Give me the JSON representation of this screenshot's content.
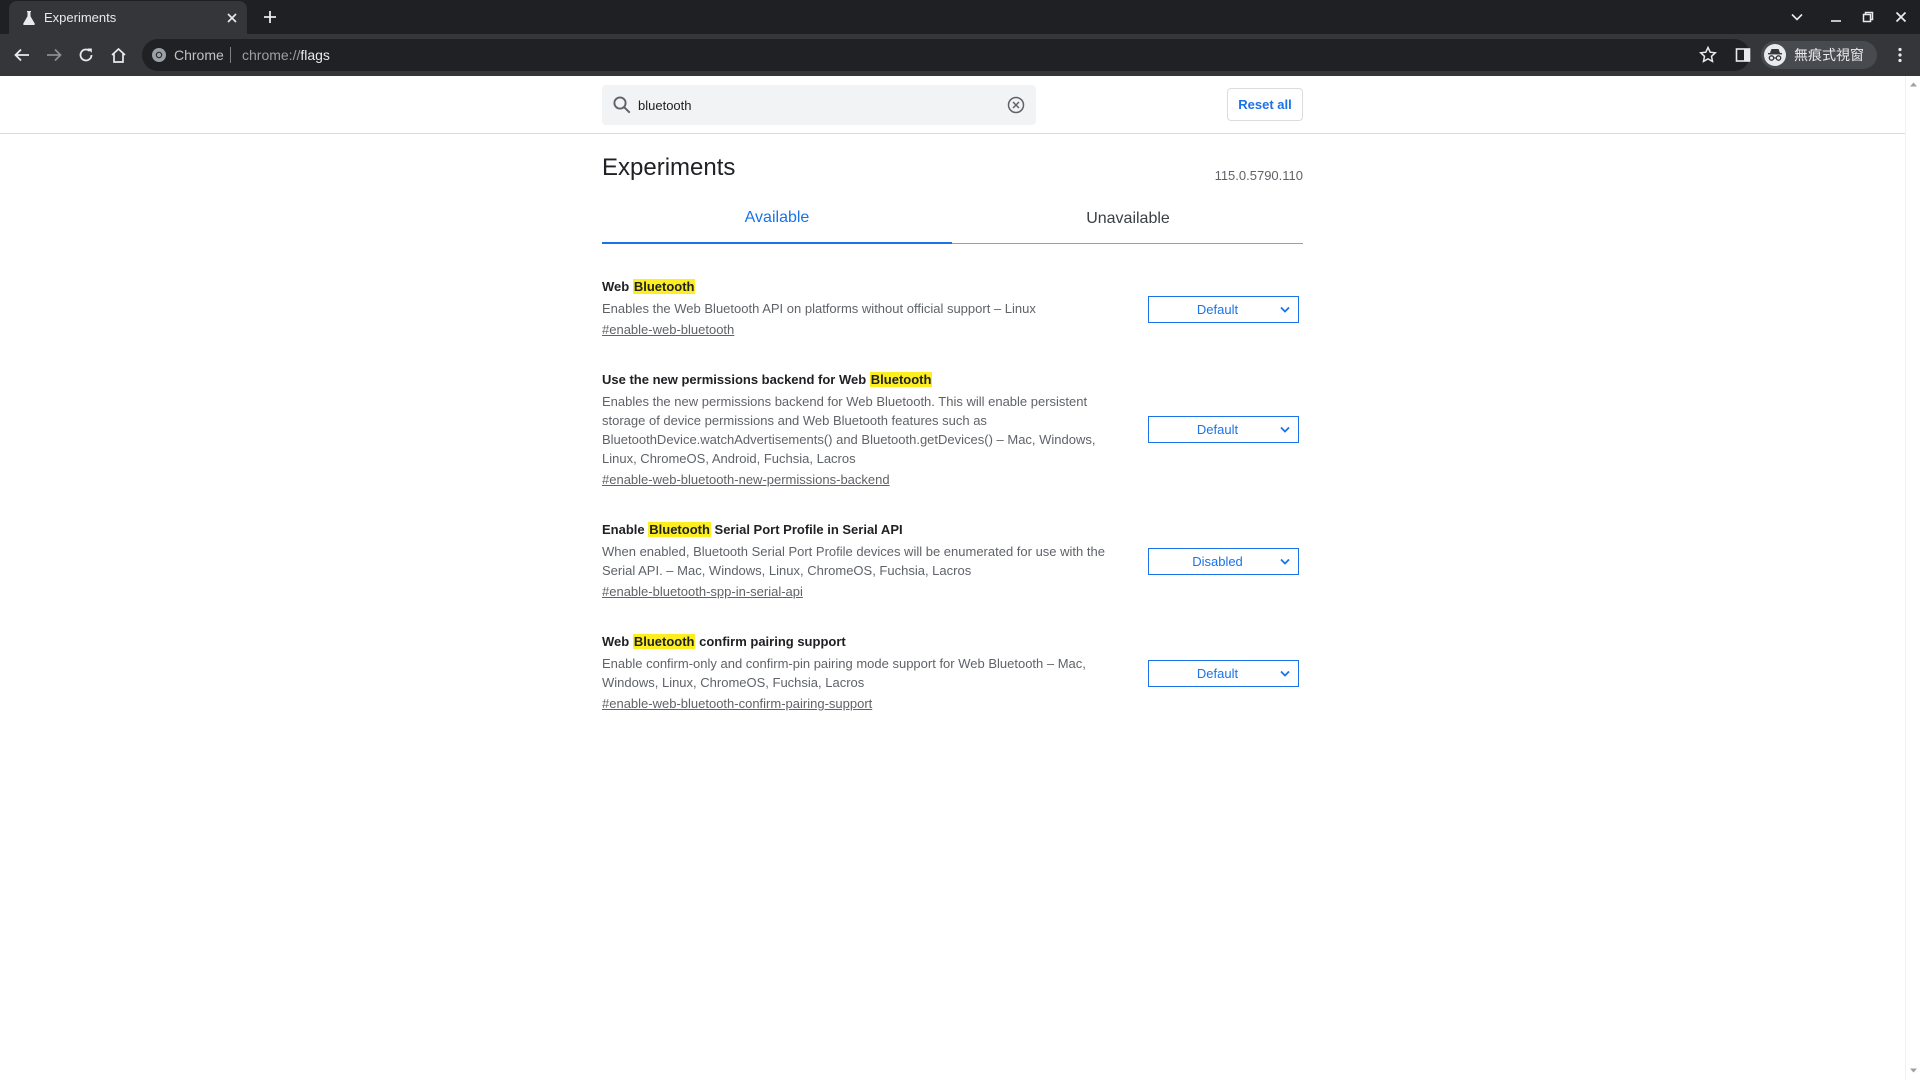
{
  "browser": {
    "tab": {
      "title": "Experiments"
    },
    "omnibox": {
      "chip_label": "Chrome",
      "url_scheme": "chrome://",
      "url_host": "flags"
    },
    "profile": {
      "label": "無痕式視窗"
    }
  },
  "header": {
    "search": {
      "value": "bluetooth",
      "placeholder": "Search flags"
    },
    "reset_label": "Reset all"
  },
  "page": {
    "title": "Experiments",
    "version": "115.0.5790.110",
    "tabs": [
      {
        "label": "Available",
        "active": true
      },
      {
        "label": "Unavailable",
        "active": false
      }
    ]
  },
  "experiments": [
    {
      "title_pre": "Web ",
      "title_hl": "Bluetooth",
      "title_post": "",
      "description": "Enables the Web Bluetooth API on platforms without official support – Linux",
      "link": "#enable-web-bluetooth",
      "value": "Default"
    },
    {
      "title_pre": "Use the new permissions backend for Web ",
      "title_hl": "Bluetooth",
      "title_post": "",
      "description": "Enables the new permissions backend for Web Bluetooth. This will enable persistent storage of device permissions and Web Bluetooth features such as BluetoothDevice.watchAdvertisements() and Bluetooth.getDevices() – Mac, Windows, Linux, ChromeOS, Android, Fuchsia, Lacros",
      "link": "#enable-web-bluetooth-new-permissions-backend",
      "value": "Default"
    },
    {
      "title_pre": "Enable ",
      "title_hl": "Bluetooth",
      "title_post": " Serial Port Profile in Serial API",
      "description": "When enabled, Bluetooth Serial Port Profile devices will be enumerated for use with the Serial API. – Mac, Windows, Linux, ChromeOS, Fuchsia, Lacros",
      "link": "#enable-bluetooth-spp-in-serial-api",
      "value": "Disabled"
    },
    {
      "title_pre": "Web ",
      "title_hl": "Bluetooth",
      "title_post": " confirm pairing support",
      "description": "Enable confirm-only and confirm-pin pairing mode support for Web Bluetooth – Mac, Windows, Linux, ChromeOS, Fuchsia, Lacros",
      "link": "#enable-web-bluetooth-confirm-pairing-support",
      "value": "Default"
    }
  ],
  "colors": {
    "accent": "#1a73e8",
    "highlight": "#fdee21",
    "tabstrip": "#1f2023",
    "toolbar": "#35363a"
  }
}
